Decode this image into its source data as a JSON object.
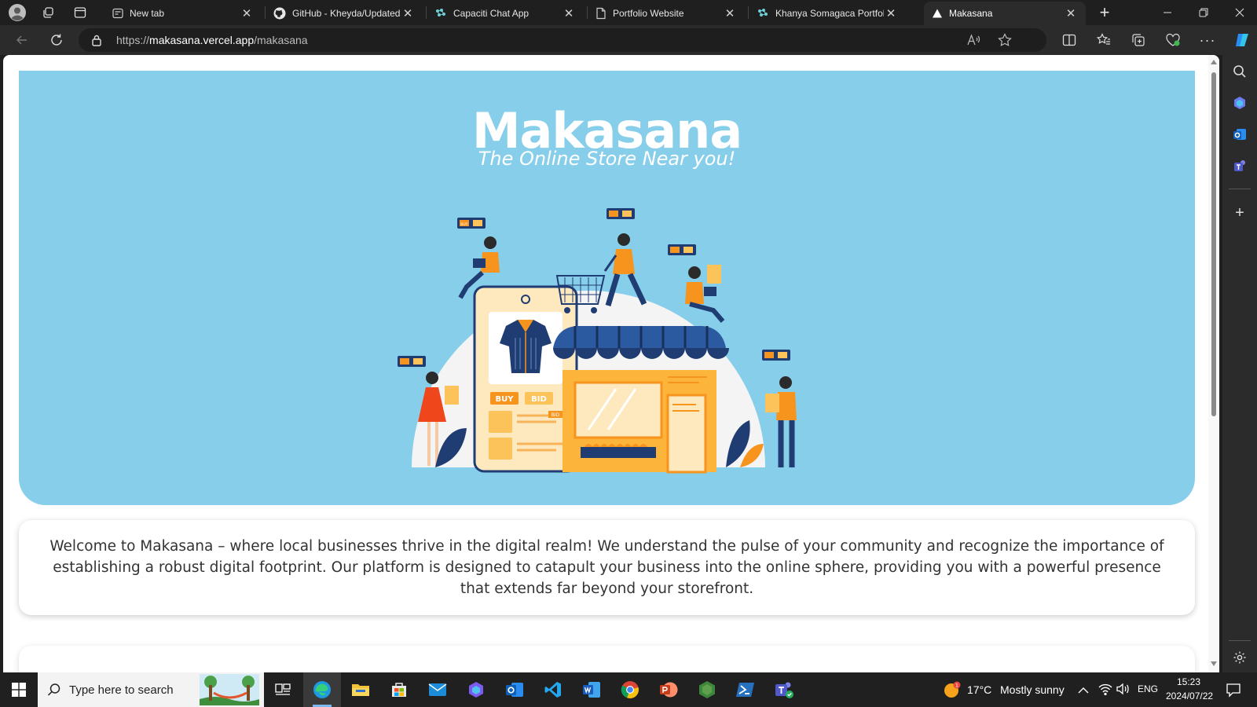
{
  "browser": {
    "tabs": [
      {
        "title": "New tab",
        "icon": "newtab-page-icon"
      },
      {
        "title": "GitHub - Kheyda/UpdatedC",
        "icon": "github-icon"
      },
      {
        "title": "Capaciti Chat App",
        "icon": "capaciti-icon"
      },
      {
        "title": "Portfolio Website",
        "icon": "page-icon"
      },
      {
        "title": "Khanya Somagaca Portfolio",
        "icon": "capaciti-icon"
      },
      {
        "title": "Makasana",
        "icon": "vercel-icon",
        "active": true
      }
    ],
    "url": {
      "prefix": "https://",
      "host": "makasana.vercel.app",
      "path": "/makasana"
    }
  },
  "page": {
    "hero": {
      "title": "Makasana",
      "tagline": "The Online Store Near you!",
      "background": "#87ceeb",
      "illustration_labels": {
        "buy": "BUY",
        "bid": "BID",
        "buy_small": "BUY",
        "bid_small": "BID"
      }
    },
    "welcome": {
      "text": "Welcome to Makasana – where local businesses thrive in the digital realm! We understand the pulse of your community and recognize the importance of establishing a robust digital footprint. Our platform is designed to catapult your business into the online sphere, providing you with a powerful presence that extends far beyond your storefront."
    }
  },
  "taskbar": {
    "search_placeholder": "Type here to search",
    "apps": [
      "task-view-icon",
      "edge-icon",
      "file-explorer-icon",
      "microsoft-store-icon",
      "mail-icon",
      "copilot-app-icon",
      "outlook-icon",
      "vscode-icon",
      "word-icon",
      "chrome-icon",
      "powerpoint-icon",
      "nodejs-icon",
      "powershell-icon",
      "teams-icon"
    ],
    "weather": {
      "temp": "17°C",
      "condition": "Mostly sunny"
    },
    "language": "ENG",
    "time": "15:23",
    "date": "2024/07/22"
  },
  "colors": {
    "accent": "#87ceeb",
    "orange": "#f7941d",
    "navy": "#1f3c73"
  }
}
